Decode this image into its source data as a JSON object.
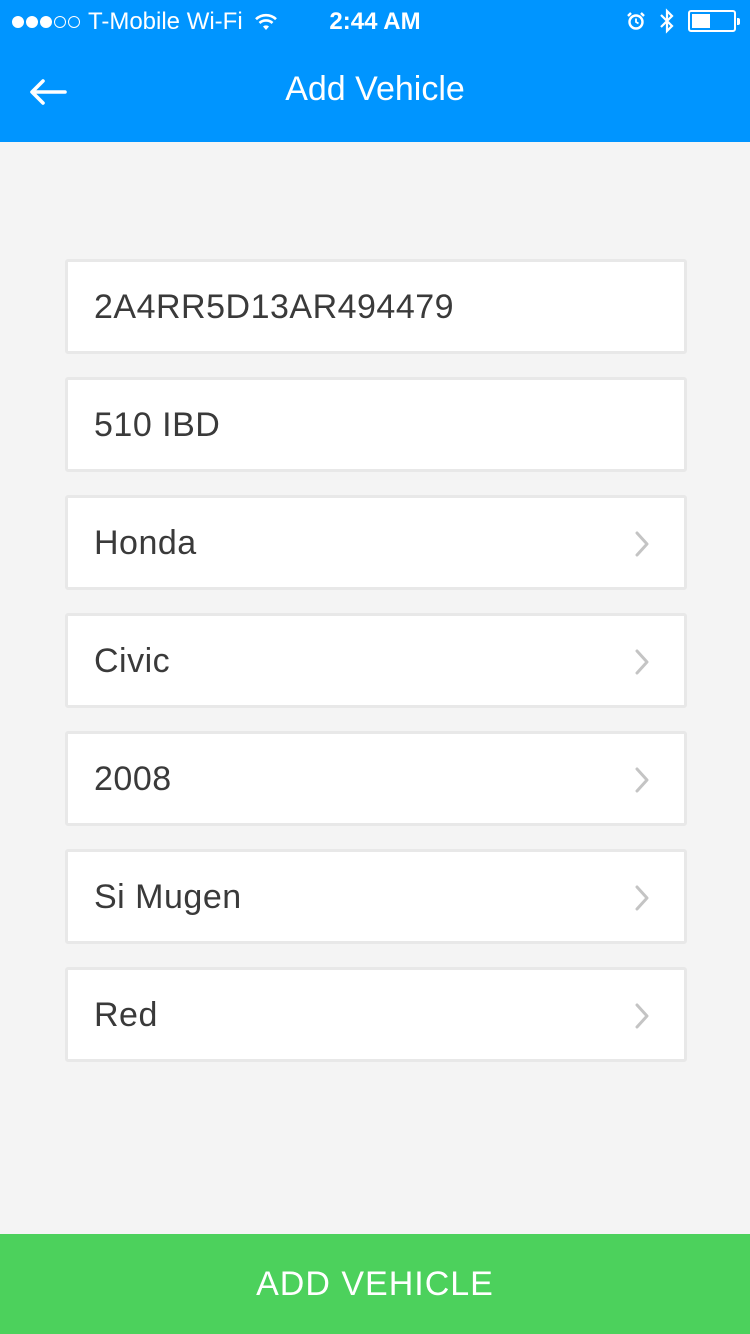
{
  "status_bar": {
    "carrier": "T-Mobile Wi-Fi",
    "time": "2:44 AM",
    "signal_bars_filled": 3,
    "signal_bars_total": 5,
    "battery_level": 0.45,
    "icons": [
      "wifi-icon",
      "alarm-icon",
      "bluetooth-icon",
      "battery-icon"
    ]
  },
  "nav": {
    "title": "Add Vehicle",
    "back_icon": "arrow-left-icon"
  },
  "fields": [
    {
      "value": "2A4RR5D13AR494479",
      "has_chevron": false
    },
    {
      "value": "510 IBD",
      "has_chevron": false
    },
    {
      "value": "Honda",
      "has_chevron": true
    },
    {
      "value": "Civic",
      "has_chevron": true
    },
    {
      "value": "2008",
      "has_chevron": true
    },
    {
      "value": "Si Mugen",
      "has_chevron": true
    },
    {
      "value": "Red",
      "has_chevron": true
    }
  ],
  "footer": {
    "button_label": "ADD VEHICLE"
  },
  "colors": {
    "header": "#0095ff",
    "footer": "#4cd15c",
    "background": "#f4f4f4"
  }
}
